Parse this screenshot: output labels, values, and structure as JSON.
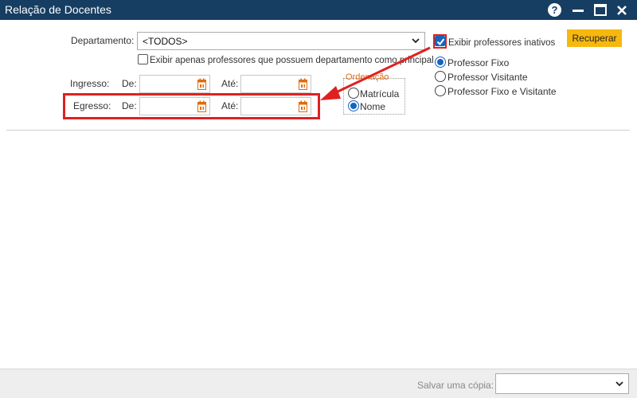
{
  "window": {
    "title": "Relação de Docentes",
    "help_glyph": "?"
  },
  "filters": {
    "departamento_label": "Departamento:",
    "departamento_value": "<TODOS>",
    "only_with_department_label": "Exibir apenas professores que possuem departamento como principal",
    "show_inactive_label": "Exibir professores inativos",
    "show_inactive_checked": true,
    "ingresso_label": "Ingresso:",
    "egresso_label": "Egresso:",
    "de_label": "De:",
    "ate_label": "Até:",
    "ingresso_de_value": "",
    "ingresso_ate_value": "",
    "egresso_de_value": "",
    "egresso_ate_value": ""
  },
  "ordenacao": {
    "legend": "Ordenação",
    "options": [
      "Matrícula",
      "Nome"
    ],
    "selected": "Nome"
  },
  "tipo_professor": {
    "options": [
      "Professor Fixo",
      "Professor Visitante",
      "Professor Fixo e Visitante"
    ],
    "selected": "Professor Fixo"
  },
  "actions": {
    "recuperar_label": "Recuperar"
  },
  "footer": {
    "salvar_label": "Salvar uma cópia:",
    "salvar_value": ""
  },
  "colors": {
    "titlebar": "#163e63",
    "accent_button": "#f6b80e",
    "legend_text": "#e36c09",
    "annotation": "#e02020",
    "calendar_icon": "#e36c09"
  },
  "icons": [
    "help-icon",
    "minimize-icon",
    "maximize-icon",
    "close-icon",
    "chevron-down-icon",
    "calendar-icon",
    "check-icon",
    "arrow-annotation-icon"
  ]
}
